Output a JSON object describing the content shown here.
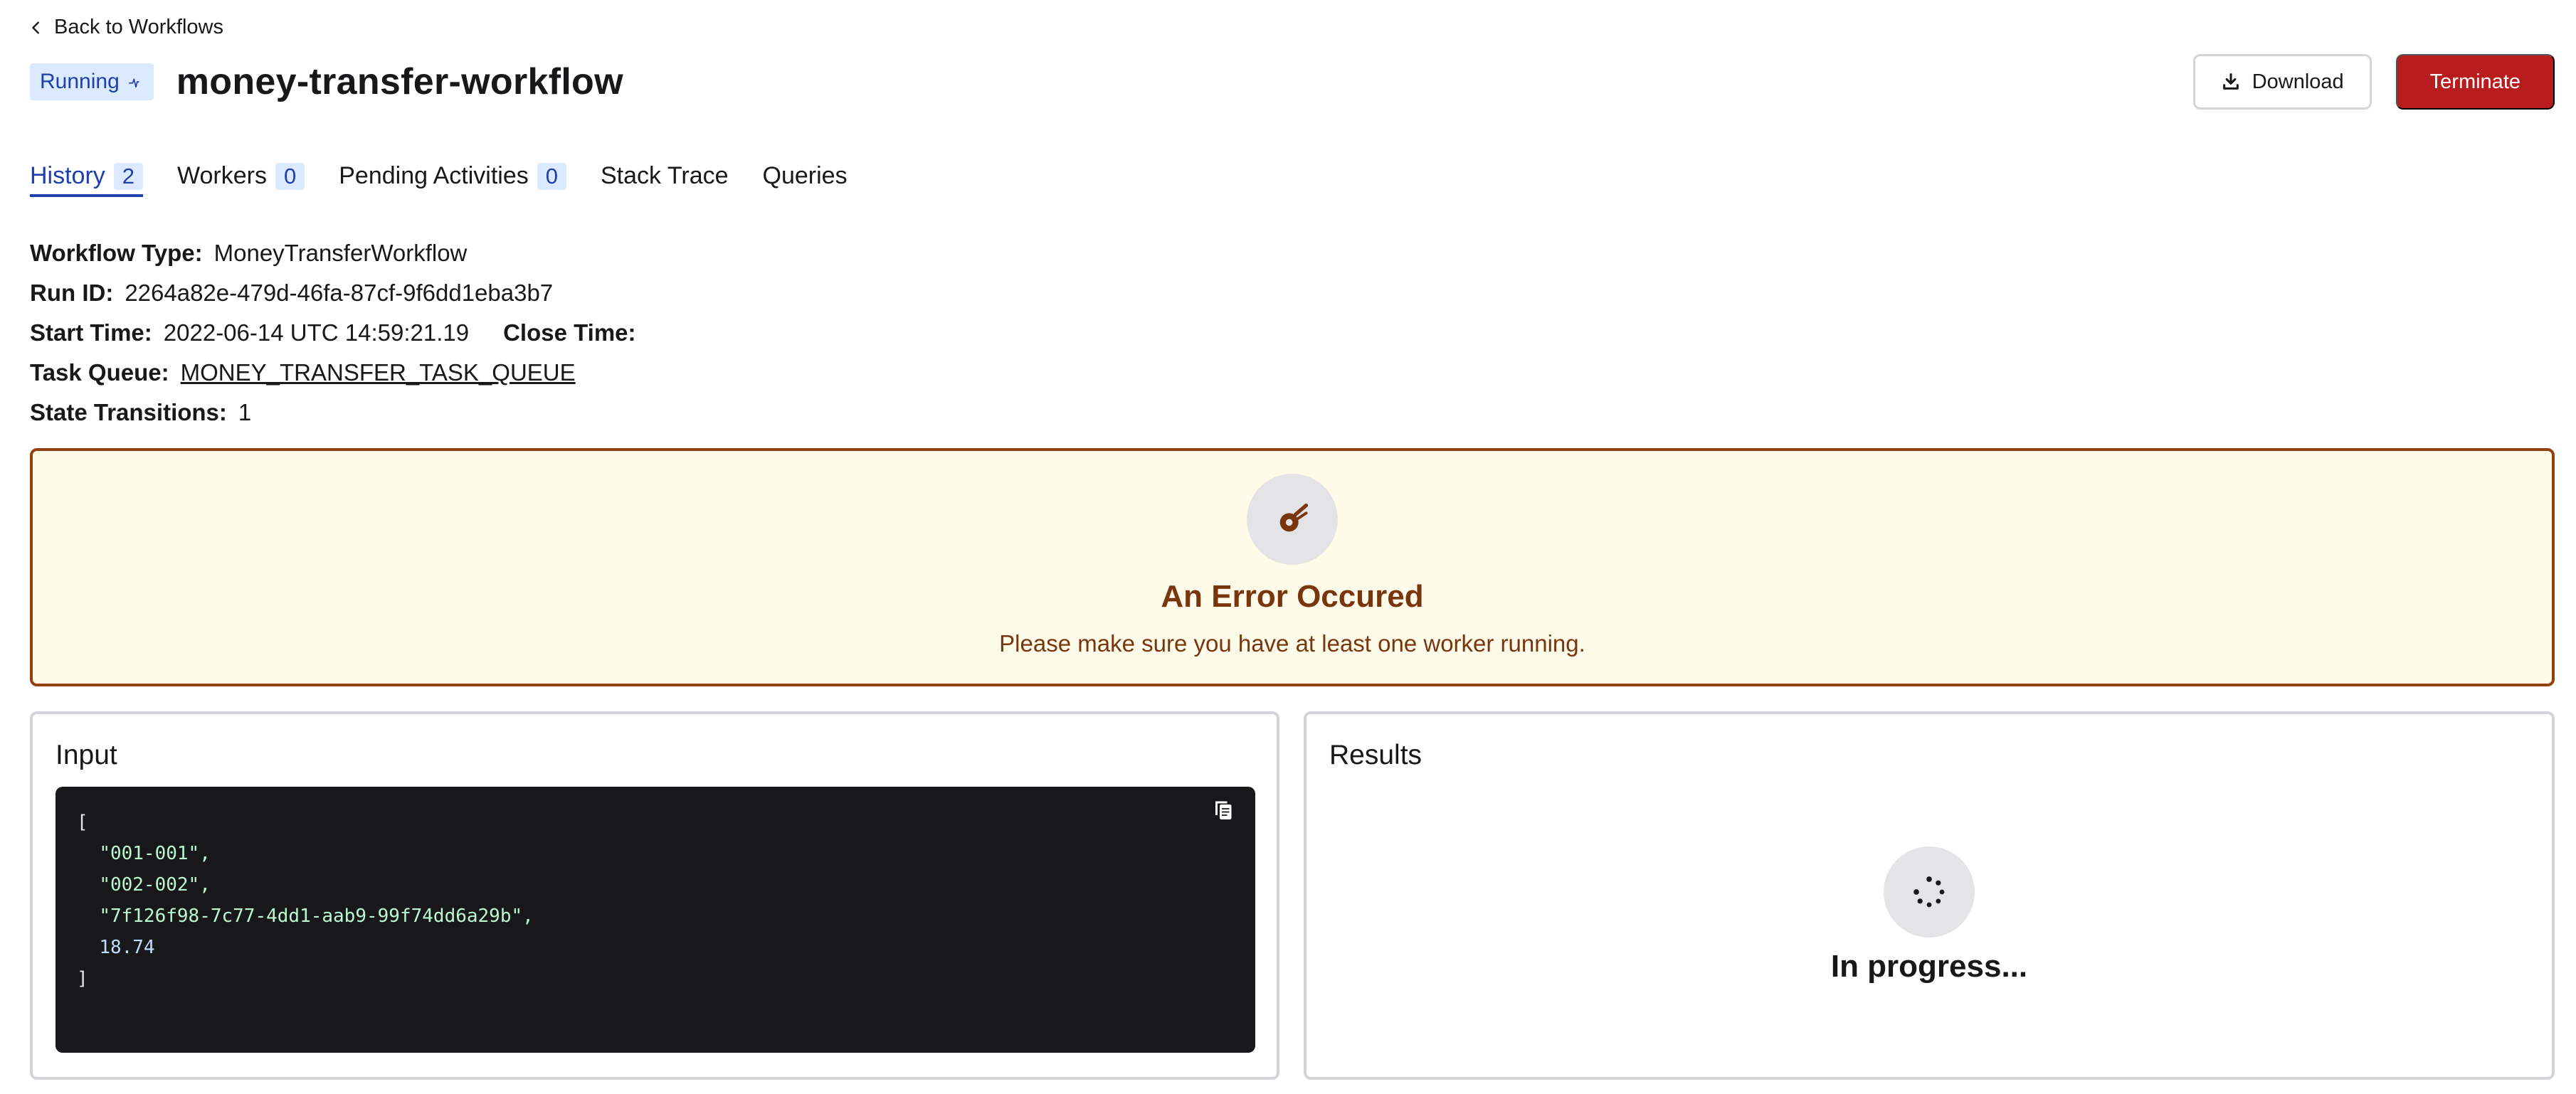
{
  "nav": {
    "back_label": "Back to Workflows"
  },
  "header": {
    "status": "Running",
    "title": "money-transfer-workflow",
    "download_label": "Download",
    "terminate_label": "Terminate"
  },
  "tabs": [
    {
      "label": "History",
      "count": "2",
      "active": true
    },
    {
      "label": "Workers",
      "count": "0"
    },
    {
      "label": "Pending Activities",
      "count": "0"
    },
    {
      "label": "Stack Trace"
    },
    {
      "label": "Queries"
    }
  ],
  "details": {
    "workflow_type_label": "Workflow Type:",
    "workflow_type": "MoneyTransferWorkflow",
    "run_id_label": "Run ID:",
    "run_id": "2264a82e-479d-46fa-87cf-9f6dd1eba3b7",
    "start_time_label": "Start Time:",
    "start_time": "2022-06-14 UTC 14:59:21.19",
    "close_time_label": "Close Time:",
    "task_queue_label": "Task Queue:",
    "task_queue": "MONEY_TRANSFER_TASK_QUEUE",
    "state_transitions_label": "State Transitions:",
    "state_transitions": "1"
  },
  "error": {
    "title": "An Error Occured",
    "message": "Please make sure you have at least one worker running."
  },
  "input": {
    "title": "Input",
    "open_bracket": "[",
    "items": [
      "\"001-001\",",
      "\"002-002\",",
      "\"7f126f98-7c77-4dd1-aab9-99f74dd6a29b\","
    ],
    "number": "18.74",
    "close_bracket": "]"
  },
  "results": {
    "title": "Results",
    "progress_text": "In progress..."
  },
  "colors": {
    "accent": "#1e40af",
    "terminate": "#b91c1c",
    "error_border": "#92400e",
    "error_bg": "#fefce8",
    "code_bg": "#18181b"
  }
}
